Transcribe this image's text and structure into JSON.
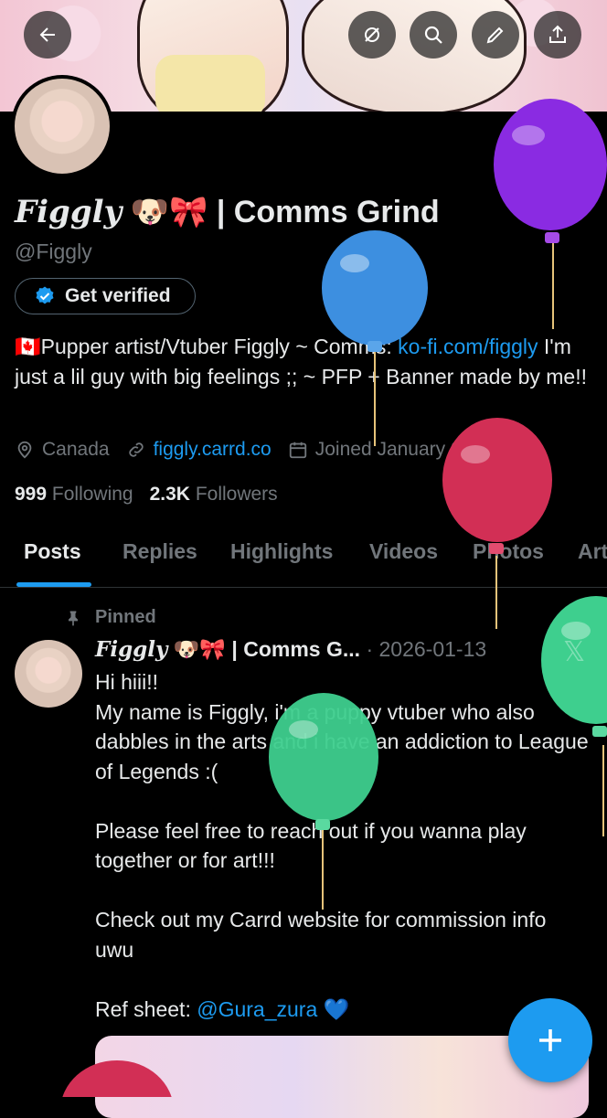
{
  "profile": {
    "display_name_script": "Figgly",
    "display_name_emoji": "🐶🎀",
    "display_name_rest": " | Comms Grind",
    "handle": "@Figgly",
    "verify_label": "Get verified",
    "bio_flag": "🇨🇦",
    "bio_part1": "Pupper artist/Vtuber Figgly ~ Comms: ",
    "bio_link1": "ko-fi.com/figgly",
    "bio_part2": " I'm just a lil guy with big feelings ;; ~ PFP + Banner made by me!!",
    "location": "Canada",
    "website": "figgly.carrd.co",
    "joined": "Joined January 2022",
    "following_count": "999",
    "following_label": "Following",
    "followers_count": "2.3K",
    "followers_label": "Followers"
  },
  "tabs": [
    "Posts",
    "Replies",
    "Highlights",
    "Videos",
    "Photos",
    "Art"
  ],
  "pinned_post": {
    "pinned_label": "Pinned",
    "author_script": "Figgly",
    "author_emoji": "🐶🎀",
    "author_rest": " | Comms G...",
    "date": "2026-01-13",
    "text": "Hi hiii!!\nMy name is Figgly, i'm a puppy vtuber who also dabbles in the arts and i have an addiction to League of Legends :(\n\nPlease feel free to reach out if you wanna play together or for art!!!\n\nCheck out my Carrd website for commission info uwu\n\n",
    "ref_label": "Ref sheet: ",
    "ref_link": "@Gura_zura",
    "ref_heart": "💙"
  },
  "colors": {
    "accent": "#1d9bf0",
    "balloon_purple": "#8a2be2",
    "balloon_blue": "#3d8fe0",
    "balloon_red": "#d22f55",
    "balloon_green": "#3ecf8e"
  },
  "icons": [
    "back-arrow-icon",
    "offline-icon",
    "search-icon",
    "edit-icon",
    "share-icon",
    "verified-badge-icon",
    "location-icon",
    "link-icon",
    "calendar-icon",
    "pin-icon",
    "compose-plus-icon"
  ]
}
